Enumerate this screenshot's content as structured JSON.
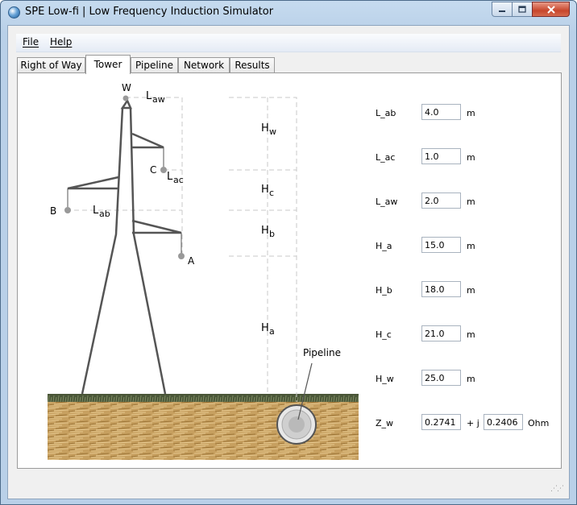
{
  "window": {
    "title": "SPE Low-fi | Low Frequency Induction Simulator",
    "minimize_icon": "minimize-icon",
    "maximize_icon": "maximize-icon",
    "close_icon": "close-icon"
  },
  "menu": {
    "file": "File",
    "help": "Help"
  },
  "tabs": [
    {
      "label": "Right of Way"
    },
    {
      "label": "Tower",
      "active": true
    },
    {
      "label": "Pipeline"
    },
    {
      "label": "Network"
    },
    {
      "label": "Results"
    }
  ],
  "diagram": {
    "labels": {
      "W": "W",
      "A": "A",
      "B": "B",
      "C": "C",
      "L_aw_main": "L",
      "L_aw_sub": "aw",
      "L_ac_main": "L",
      "L_ac_sub": "ac",
      "L_ab_main": "L",
      "L_ab_sub": "ab",
      "H_w_main": "H",
      "H_w_sub": "w",
      "H_c_main": "H",
      "H_c_sub": "c",
      "H_b_main": "H",
      "H_b_sub": "b",
      "H_a_main": "H",
      "H_a_sub": "a",
      "pipeline": "Pipeline"
    }
  },
  "fields": [
    {
      "label": "L_ab",
      "value": "4.0",
      "unit": "m"
    },
    {
      "label": "L_ac",
      "value": "1.0",
      "unit": "m"
    },
    {
      "label": "L_aw",
      "value": "2.0",
      "unit": "m"
    },
    {
      "label": "H_a",
      "value": "15.0",
      "unit": "m"
    },
    {
      "label": "H_b",
      "value": "18.0",
      "unit": "m"
    },
    {
      "label": "H_c",
      "value": "21.0",
      "unit": "m"
    },
    {
      "label": "H_w",
      "value": "25.0",
      "unit": "m"
    }
  ],
  "impedance": {
    "label": "Z_w",
    "real": "0.2741",
    "separator": "+ j",
    "imag": "0.2406",
    "unit": "Ohm"
  },
  "colors": {
    "tower": "#555555",
    "dashed": "#c8c8c8",
    "node": "#999999",
    "grass": "#3e4a30",
    "soil": "#c7a060"
  }
}
